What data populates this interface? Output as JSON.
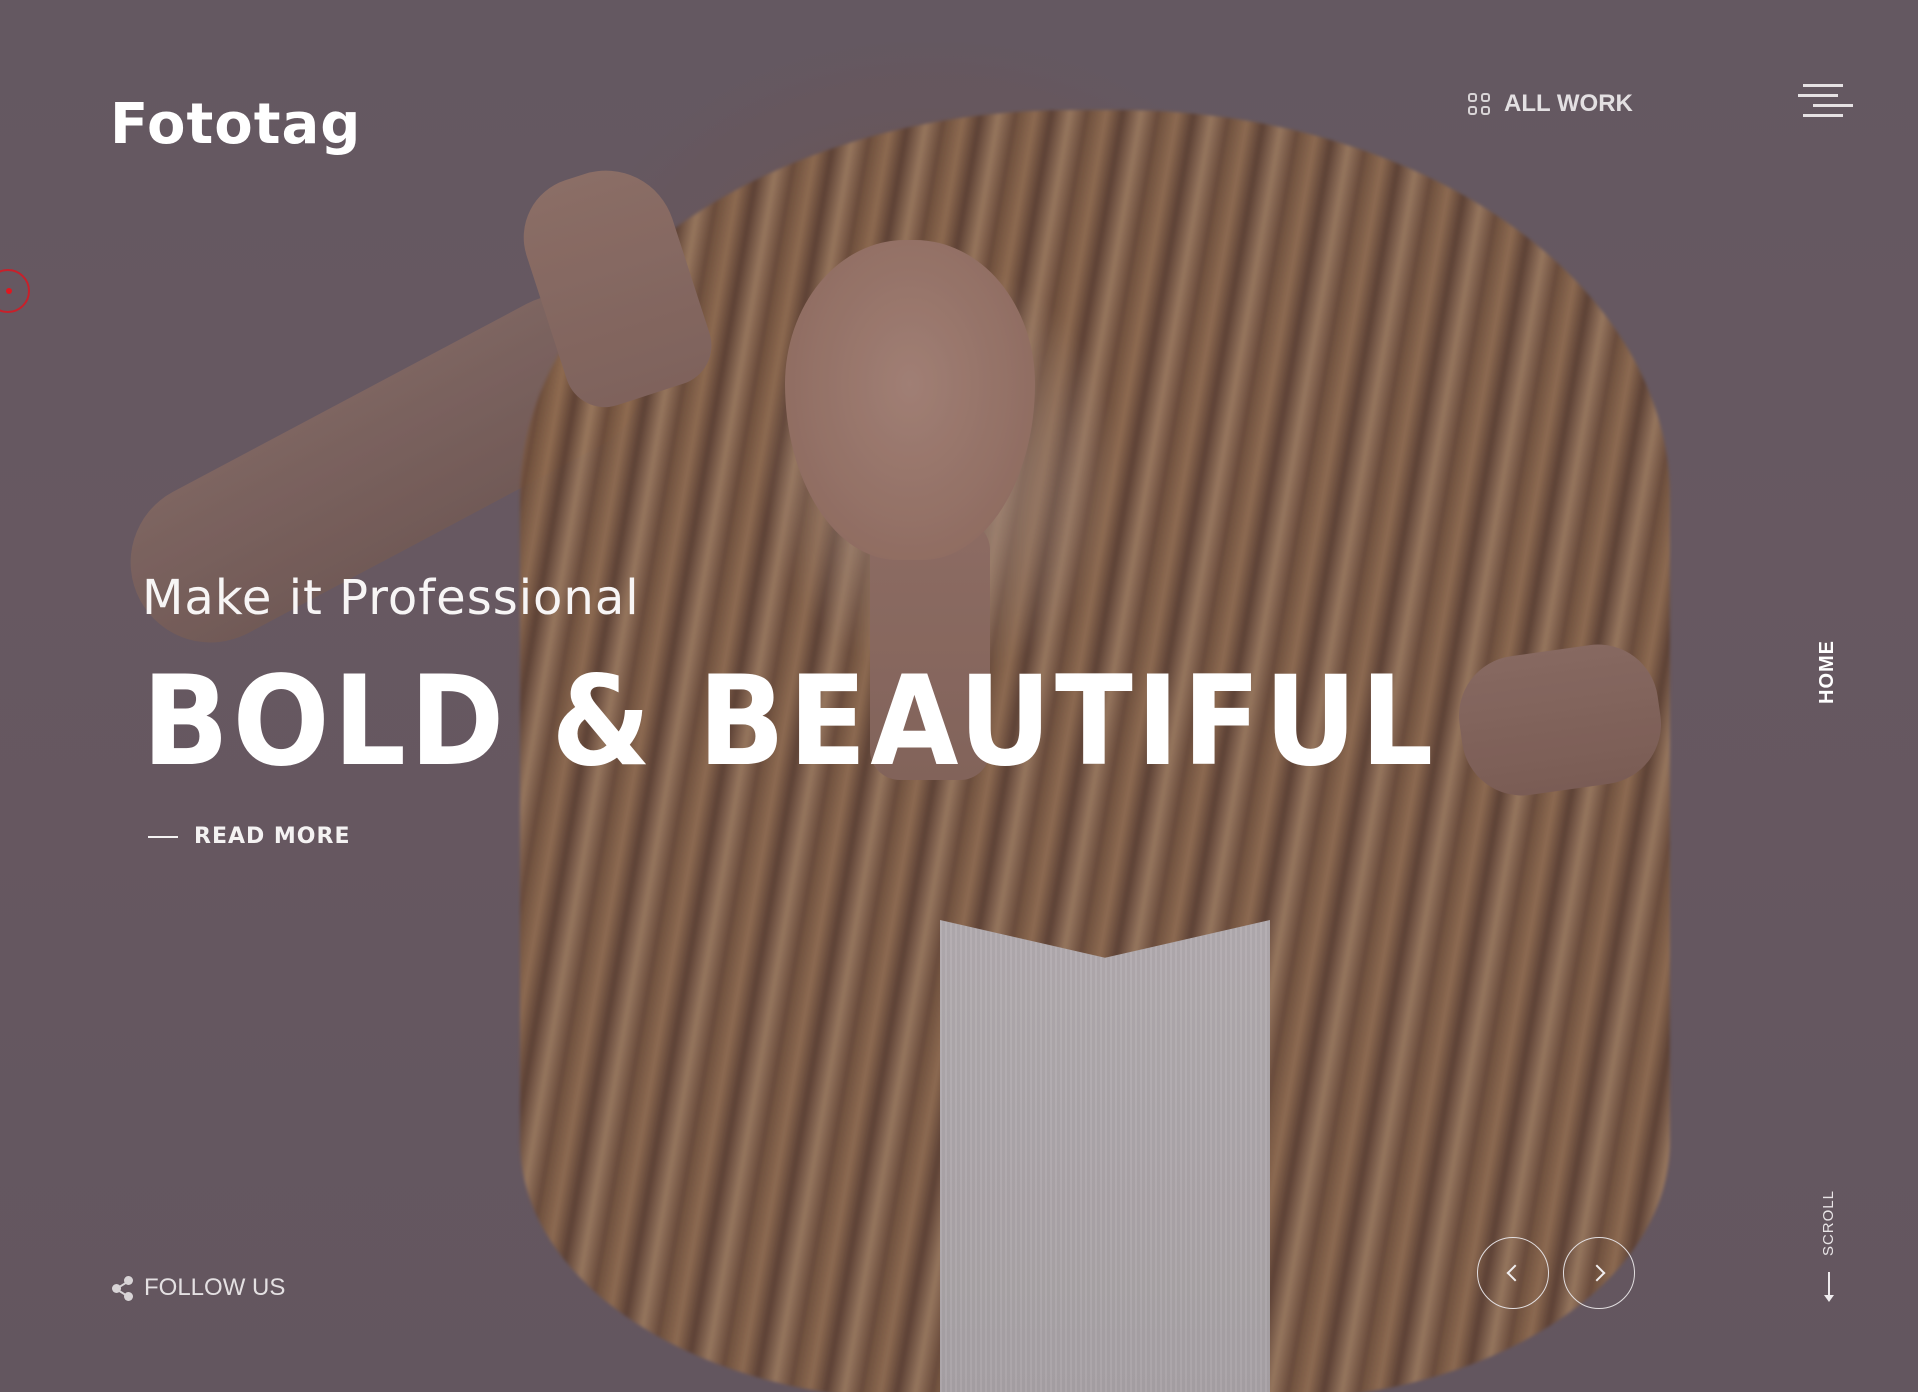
{
  "brand": {
    "logo_text": "Fototag"
  },
  "header": {
    "all_work_label": "ALL WORK",
    "all_work_icon": "grid-icon",
    "menu_icon": "hamburger-menu-icon"
  },
  "hero": {
    "tagline": "Make it Professional",
    "headline": "BOLD & BEAUTIFUL",
    "read_more_label": "READ MORE",
    "background_image": "woman-with-long-wavy-hair-against-pink-wall"
  },
  "side_nav": {
    "current_section": "HOME",
    "scroll_label": "SCROLL",
    "scroll_icon": "arrow-down-icon"
  },
  "footer": {
    "follow_us_label": "FOLLOW US",
    "follow_us_icon": "share-icon"
  },
  "slider": {
    "prev_icon": "chevron-left-icon",
    "next_icon": "chevron-right-icon"
  },
  "cursor": {
    "icon": "custom-cursor-ring-icon",
    "color": "#d21a24"
  },
  "colors": {
    "overlay_background": "#6a5f68",
    "text_primary": "#ffffff",
    "text_muted": "#e3e0e2"
  }
}
